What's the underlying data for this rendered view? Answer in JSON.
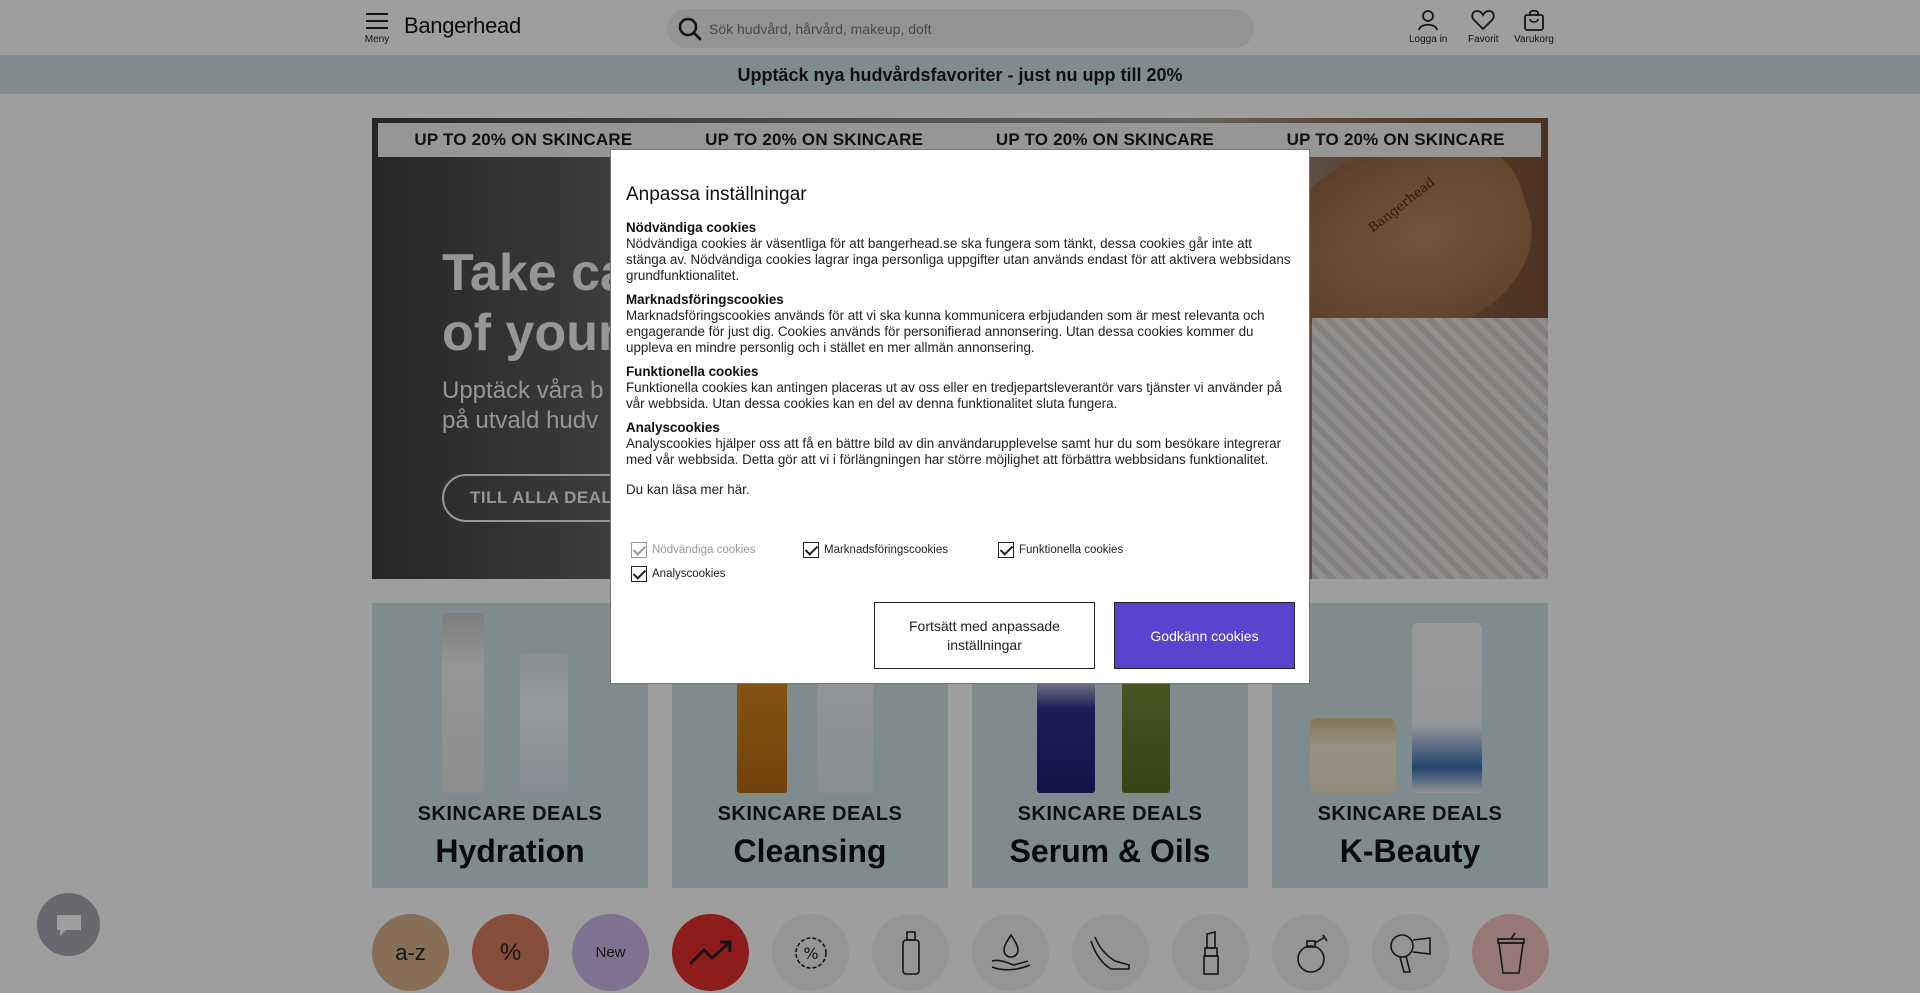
{
  "header": {
    "menu_label": "Meny",
    "logo": "Bangerhead",
    "search_placeholder": "Sök hudvård, hårvård, makeup, doft",
    "login_label": "Logga in",
    "favorites_label": "Favorit",
    "cart_label": "Varukorg"
  },
  "promo_bar": "Upptäck nya hudvårdsfavoriter - just nu upp till 20%",
  "hero": {
    "ticker": [
      "UP TO 20% ON SKINCARE",
      "UP TO 20% ON SKINCARE",
      "UP TO 20% ON SKINCARE",
      "UP TO 20% ON SKINCARE"
    ],
    "title_line1": "Take ca",
    "title_line2": "of your",
    "subtitle_line1": "Upptäck våra b",
    "subtitle_line2": "på utvald hudv",
    "button": "TILL ALLA DEALS",
    "brush_text": "Bangerhead"
  },
  "categories": [
    {
      "label": "SKINCARE DEALS",
      "title": "Hydration"
    },
    {
      "label": "SKINCARE DEALS",
      "title": "Cleansing"
    },
    {
      "label": "SKINCARE DEALS",
      "title": "Serum & Oils"
    },
    {
      "label": "SKINCARE DEALS",
      "title": "K-Beauty"
    }
  ],
  "quick_links": {
    "az": "a-z",
    "percent": "%",
    "new": "New"
  },
  "modal": {
    "title": "Anpassa inställningar",
    "sections": [
      {
        "heading": "Nödvändiga cookies",
        "text": "Nödvändiga cookies är väsentliga för att bangerhead.se ska fungera som tänkt, dessa cookies går inte att stänga av. Nödvändiga cookies lagrar inga personliga uppgifter utan används endast för att aktivera webbsidans grundfunktionalitet."
      },
      {
        "heading": "Marknadsföringscookies",
        "text": "Marknadsföringscookies används för att vi ska kunna kommunicera erbjudanden som är mest relevanta och engagerande för just dig. Cookies används för personifierad annonsering. Utan dessa cookies kommer du uppleva en mindre personlig och i stället en mer allmän annonsering."
      },
      {
        "heading": "Funktionella cookies",
        "text": "Funktionella cookies kan antingen placeras ut av oss eller en tredjepartsleverantör vars tjänster vi använder på vår webbsida. Utan dessa cookies kan en del av denna funktionalitet sluta fungera."
      },
      {
        "heading": "Analyscookies",
        "text": "Analyscookies hjälper oss att få en bättre bild av din användarupplevelse samt hur du som besökare integrerar med vår webbsida. Detta gör att vi i förlängningen har större möjlighet att förbättra webbsidans funktionalitet."
      }
    ],
    "read_more": "Du kan läsa mer här.",
    "checkboxes": {
      "necessary": "Nödvändiga cookies",
      "marketing": "Marknadsföringscookies",
      "functional": "Funktionella cookies",
      "analytics": "Analyscookies"
    },
    "continue_button": "Fortsätt med anpassade inställningar",
    "accept_button": "Godkänn cookies"
  },
  "colors": {
    "promo_bg": "#cfe0e6",
    "accept_button": "#5a44cf",
    "card_bg": "#cfe0e6"
  }
}
